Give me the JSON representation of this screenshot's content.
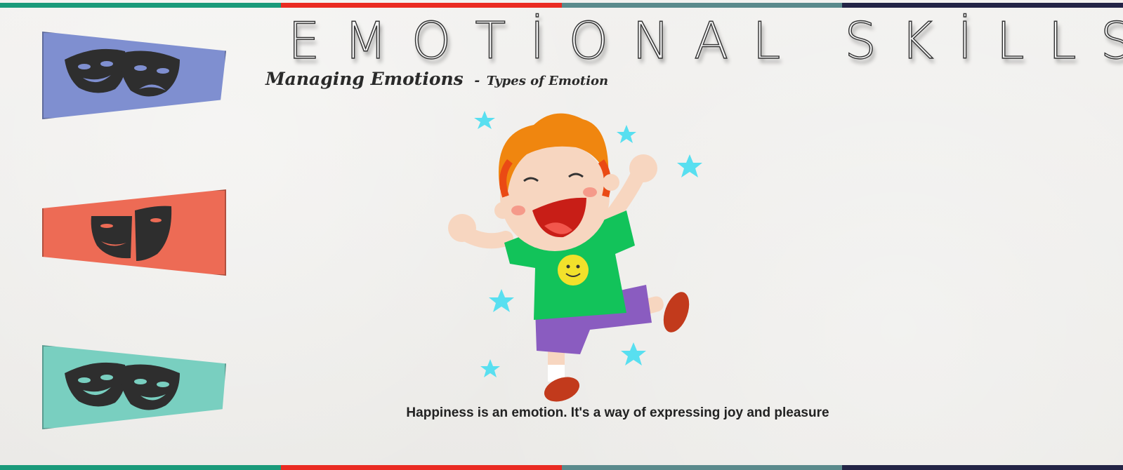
{
  "header": {
    "title": "EMOTİONAL SKİLLS",
    "subtitle_main": "Managing Emotions",
    "subtitle_separator": "-",
    "subtitle_sub": "Types of Emotion"
  },
  "caption": "Happiness is an emotion. It's a way of expressing joy and pleasure",
  "stripe_colors": [
    "#1a9a7a",
    "#ea2b22",
    "#5a8a8c",
    "#232446"
  ],
  "panels": [
    {
      "name": "comedy-tragedy-masks",
      "color": "#7f8fd0",
      "icon": "theater-masks-icon"
    },
    {
      "name": "split-face-mask",
      "color": "#ed6b55",
      "icon": "split-mask-icon"
    },
    {
      "name": "happy-masks",
      "color": "#79cfc0",
      "icon": "theater-masks-icon"
    }
  ],
  "illustration": {
    "icon": "happy-jumping-boy-icon",
    "colors": {
      "hair": "#f0860f",
      "shirt": "#12c35a",
      "shorts": "#8a5cc0",
      "stars": "#58dff0",
      "shoes": "#c23a1c"
    }
  }
}
